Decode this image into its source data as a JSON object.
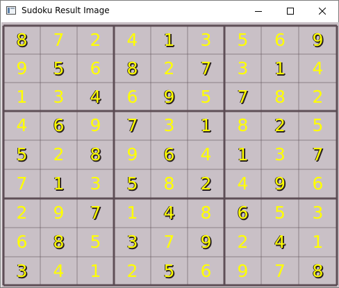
{
  "window": {
    "title": "Sudoku Result Image",
    "icon": "app-window-icon",
    "controls": [
      "minimize-icon",
      "maximize-icon",
      "close-icon"
    ]
  },
  "board": {
    "cells": [
      [
        {
          "v": "8",
          "p": true
        },
        {
          "v": "7",
          "p": false
        },
        {
          "v": "2",
          "p": false
        },
        {
          "v": "4",
          "p": false
        },
        {
          "v": "1",
          "p": true
        },
        {
          "v": "3",
          "p": false
        },
        {
          "v": "5",
          "p": false
        },
        {
          "v": "6",
          "p": false
        },
        {
          "v": "9",
          "p": true
        }
      ],
      [
        {
          "v": "9",
          "p": false
        },
        {
          "v": "5",
          "p": true
        },
        {
          "v": "6",
          "p": false
        },
        {
          "v": "8",
          "p": true
        },
        {
          "v": "2",
          "p": false
        },
        {
          "v": "7",
          "p": true
        },
        {
          "v": "3",
          "p": false
        },
        {
          "v": "1",
          "p": true
        },
        {
          "v": "4",
          "p": false
        }
      ],
      [
        {
          "v": "1",
          "p": false
        },
        {
          "v": "3",
          "p": false
        },
        {
          "v": "4",
          "p": true
        },
        {
          "v": "6",
          "p": false
        },
        {
          "v": "9",
          "p": true
        },
        {
          "v": "5",
          "p": false
        },
        {
          "v": "7",
          "p": true
        },
        {
          "v": "8",
          "p": false
        },
        {
          "v": "2",
          "p": false
        }
      ],
      [
        {
          "v": "4",
          "p": false
        },
        {
          "v": "6",
          "p": true
        },
        {
          "v": "9",
          "p": false
        },
        {
          "v": "7",
          "p": true
        },
        {
          "v": "3",
          "p": false
        },
        {
          "v": "1",
          "p": true
        },
        {
          "v": "8",
          "p": false
        },
        {
          "v": "2",
          "p": true
        },
        {
          "v": "5",
          "p": false
        }
      ],
      [
        {
          "v": "5",
          "p": true
        },
        {
          "v": "2",
          "p": false
        },
        {
          "v": "8",
          "p": true
        },
        {
          "v": "9",
          "p": false
        },
        {
          "v": "6",
          "p": true
        },
        {
          "v": "4",
          "p": false
        },
        {
          "v": "1",
          "p": true
        },
        {
          "v": "3",
          "p": false
        },
        {
          "v": "7",
          "p": true
        }
      ],
      [
        {
          "v": "7",
          "p": false
        },
        {
          "v": "1",
          "p": true
        },
        {
          "v": "3",
          "p": false
        },
        {
          "v": "5",
          "p": true
        },
        {
          "v": "8",
          "p": false
        },
        {
          "v": "2",
          "p": true
        },
        {
          "v": "4",
          "p": false
        },
        {
          "v": "9",
          "p": true
        },
        {
          "v": "6",
          "p": false
        }
      ],
      [
        {
          "v": "2",
          "p": false
        },
        {
          "v": "9",
          "p": false
        },
        {
          "v": "7",
          "p": true
        },
        {
          "v": "1",
          "p": false
        },
        {
          "v": "4",
          "p": true
        },
        {
          "v": "8",
          "p": false
        },
        {
          "v": "6",
          "p": true
        },
        {
          "v": "5",
          "p": false
        },
        {
          "v": "3",
          "p": false
        }
      ],
      [
        {
          "v": "6",
          "p": false
        },
        {
          "v": "8",
          "p": true
        },
        {
          "v": "5",
          "p": false
        },
        {
          "v": "3",
          "p": true
        },
        {
          "v": "7",
          "p": false
        },
        {
          "v": "9",
          "p": true
        },
        {
          "v": "2",
          "p": false
        },
        {
          "v": "4",
          "p": true
        },
        {
          "v": "1",
          "p": false
        }
      ],
      [
        {
          "v": "3",
          "p": true
        },
        {
          "v": "4",
          "p": false
        },
        {
          "v": "1",
          "p": false
        },
        {
          "v": "2",
          "p": false
        },
        {
          "v": "5",
          "p": true
        },
        {
          "v": "6",
          "p": false
        },
        {
          "v": "9",
          "p": false
        },
        {
          "v": "7",
          "p": false
        },
        {
          "v": "8",
          "p": true
        }
      ]
    ],
    "colors": {
      "solution_digit": "#ffff00",
      "printed_digit_shadow": "#2a2222",
      "paper": "#c9c0c6",
      "grid_line": "#5a4a52"
    }
  }
}
